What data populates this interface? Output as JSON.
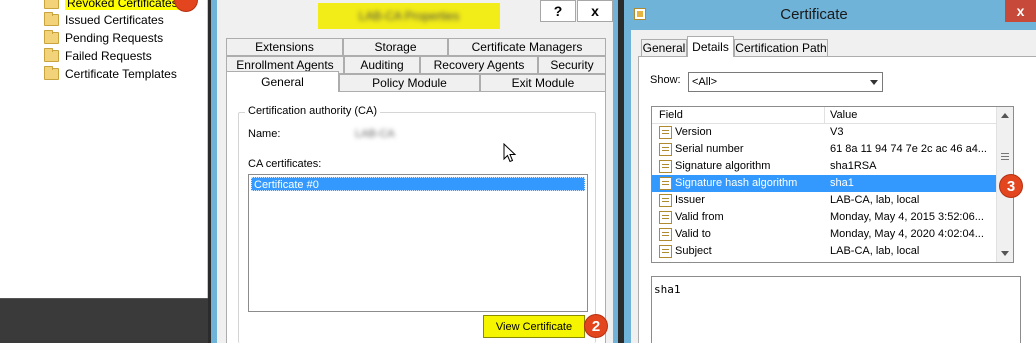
{
  "left_tree": {
    "items": [
      {
        "label": "Revoked Certificates"
      },
      {
        "label": "Issued Certificates"
      },
      {
        "label": "Pending Requests"
      },
      {
        "label": "Failed Requests"
      },
      {
        "label": "Certificate Templates"
      }
    ]
  },
  "ca_properties": {
    "title": "LAB-CA Properties",
    "title_buttons": {
      "help": "?",
      "close": "x"
    },
    "tabs_row1": [
      "Extensions",
      "Storage",
      "Certificate Managers"
    ],
    "tabs_row2": [
      "Enrollment Agents",
      "Auditing",
      "Recovery Agents",
      "Security"
    ],
    "tabs_row3": [
      "General",
      "Policy Module",
      "Exit Module"
    ],
    "active_tab": "General",
    "group_label": "Certification authority (CA)",
    "name_label": "Name:",
    "name_value": "LAB-CA",
    "ca_certs_label": "CA certificates:",
    "ca_cert_item": "Certificate #0",
    "view_button": "View Certificate",
    "badge": "2"
  },
  "certificate": {
    "title": "Certificate",
    "close": "x",
    "tabs": [
      "General",
      "Details",
      "Certification Path"
    ],
    "active_tab": "Details",
    "show_label": "Show:",
    "show_value": "<All>",
    "columns": {
      "field": "Field",
      "value": "Value"
    },
    "rows": [
      {
        "field": "Version",
        "value": "V3"
      },
      {
        "field": "Serial number",
        "value": "61 8a 11 94 74 7e 2c ac 46 a4..."
      },
      {
        "field": "Signature algorithm",
        "value": "sha1RSA"
      },
      {
        "field": "Signature hash algorithm",
        "value": "sha1"
      },
      {
        "field": "Issuer",
        "value": "LAB-CA, lab, local"
      },
      {
        "field": "Valid from",
        "value": "Monday, May 4, 2015 3:52:06..."
      },
      {
        "field": "Valid to",
        "value": "Monday, May 4, 2020 4:02:04..."
      },
      {
        "field": "Subject",
        "value": "LAB-CA, lab, local"
      }
    ],
    "selected_row": "Signature hash algorithm",
    "value_text": "sha1",
    "badge": "3"
  },
  "colors": {
    "highlight_yellow": "#ffff00",
    "selection_blue": "#3399ff",
    "badge_red": "#e3451f",
    "window_frame": "#6fb3d8"
  }
}
